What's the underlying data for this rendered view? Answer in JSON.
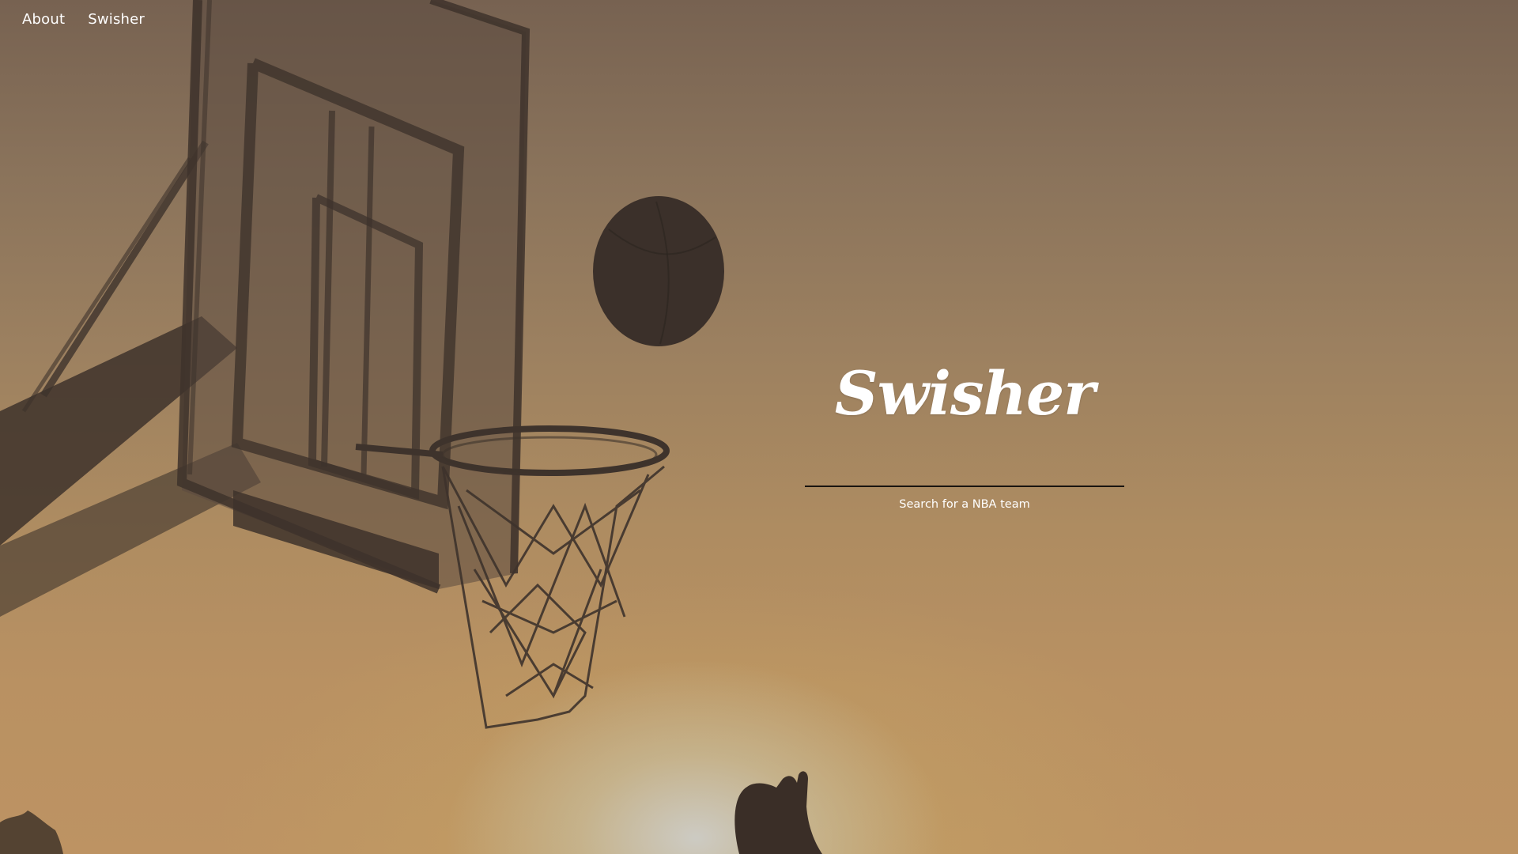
{
  "nav": {
    "items": [
      {
        "label": "About"
      },
      {
        "label": "Swisher"
      }
    ]
  },
  "hero": {
    "title": "Swisher",
    "search": {
      "value": "",
      "placeholder": "",
      "label": "Search for a NBA team"
    }
  },
  "background": {
    "subject": "basketball-hoop-silhouette-icon",
    "colors": {
      "sky_top": "#776251",
      "sky_mid": "#9d8160",
      "sky_bottom": "#bd9363",
      "silhouette": "#3e332c",
      "ball": "#3b302a",
      "sun_glow": "#cfcfc9"
    }
  }
}
